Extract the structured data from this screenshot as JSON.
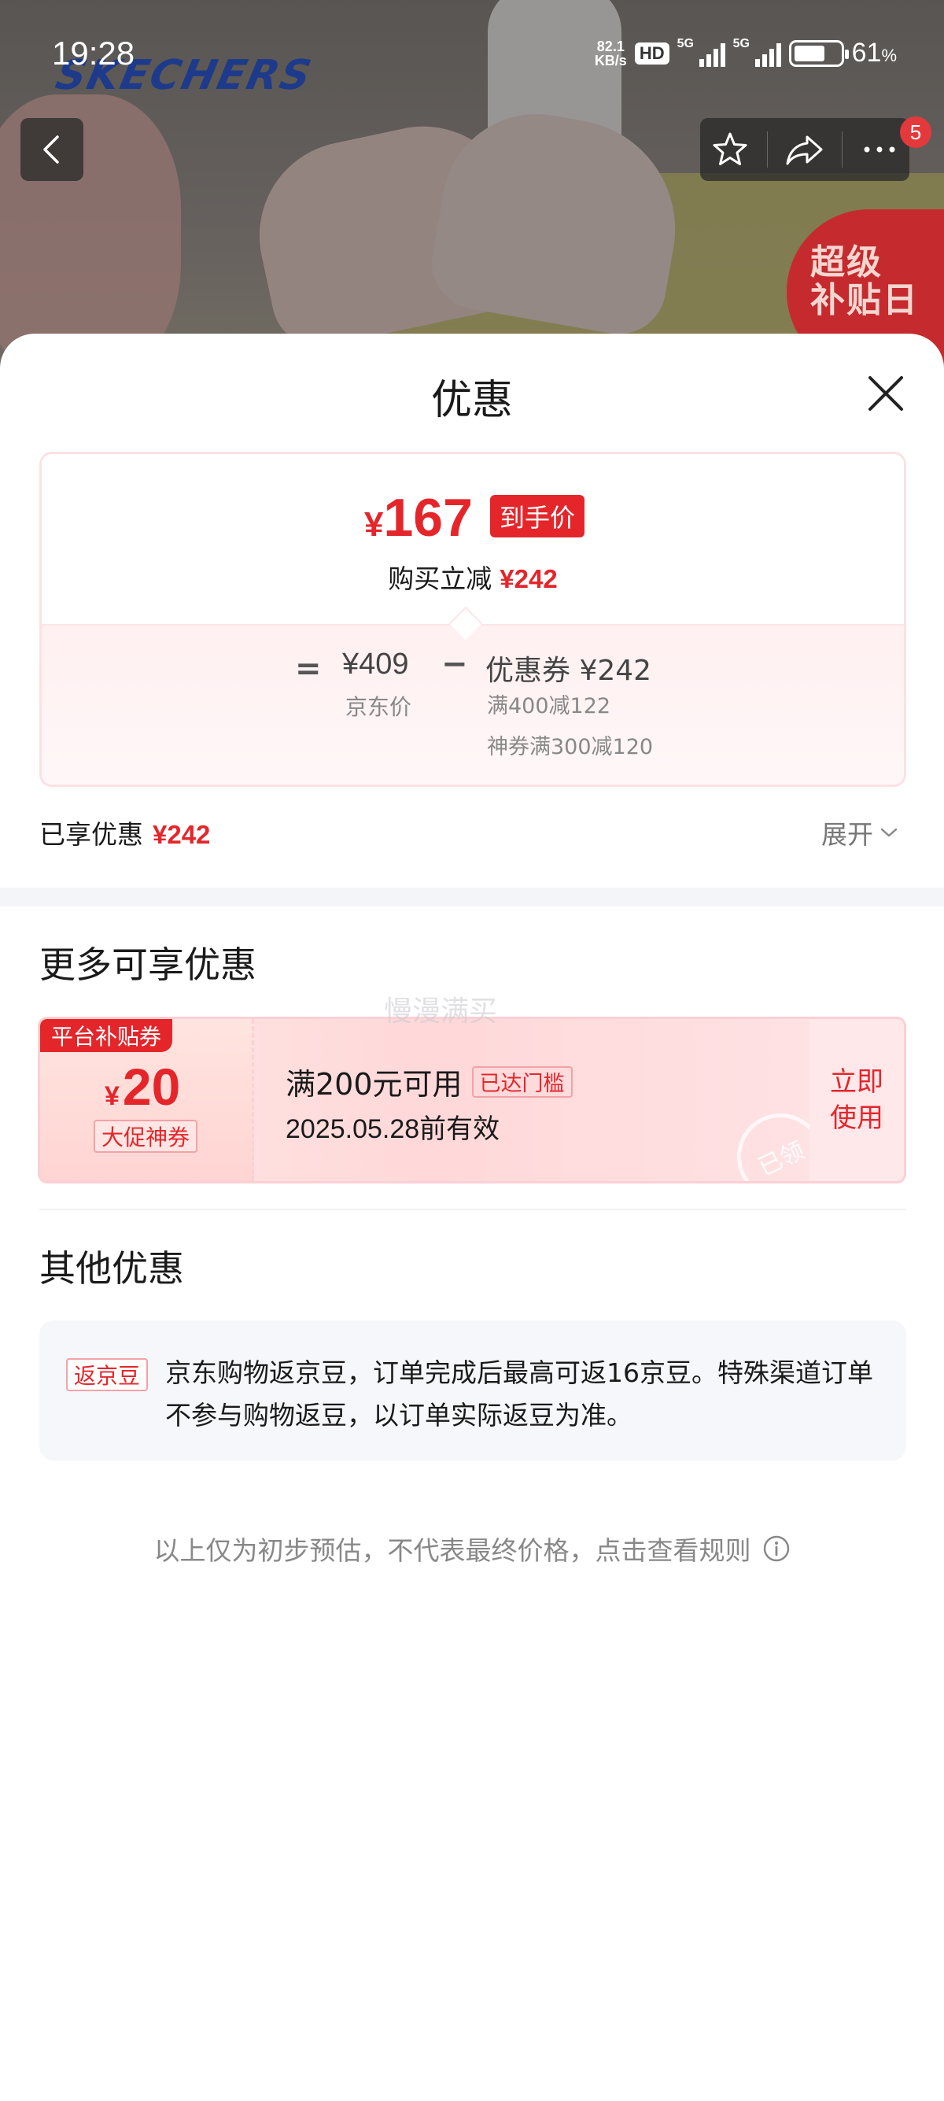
{
  "status_bar": {
    "time": "19:28",
    "net_speed_value": "82.1",
    "net_speed_unit": "KB/s",
    "hd_badge": "HD",
    "signal1_label": "5G",
    "signal2_label": "5G",
    "battery_percent": "61",
    "battery_percent_sign": "%"
  },
  "header": {
    "brand_logo": "SKECHERS",
    "back_icon": "chevron-left-icon",
    "favorite_icon": "star-icon",
    "share_icon": "share-icon",
    "more_icon": "more-dots-icon",
    "notification_count": "5",
    "promo_seal_line1": "超级",
    "promo_seal_line2": "补贴日"
  },
  "sheet": {
    "title": "优惠",
    "close_icon": "close-icon"
  },
  "price_card": {
    "final_price_symbol": "¥",
    "final_price": "167",
    "final_price_tag": "到手价",
    "instant_discount_label": "购买立减",
    "instant_discount_value": "¥242",
    "equals_sign": "=",
    "jd_price": "¥409",
    "jd_price_label": "京东价",
    "minus_sign": "−",
    "coupon_title": "优惠券 ¥242",
    "coupon_lines": [
      "满400减122",
      "神券满300减120"
    ]
  },
  "enjoyed": {
    "label": "已享优惠",
    "value": "¥242",
    "expand_label": "展开"
  },
  "more_offers": {
    "title": "更多可享优惠",
    "watermark": "慢漫满买",
    "coupon": {
      "tag": "平台补贴券",
      "currency": "¥",
      "amount": "20",
      "subtitle": "大促神券",
      "condition": "满200元可用",
      "reached_badge": "已达门槛",
      "valid_until": "2025.05.28前有效",
      "use_button_line1": "立即",
      "use_button_line2": "使用",
      "claimed_stamp": "已领"
    }
  },
  "other_offers": {
    "title": "其他优惠",
    "tag": "返京豆",
    "text": "京东购物返京豆，订单完成后最高可返16京豆。特殊渠道订单不参与购物返豆，以订单实际返豆为准。"
  },
  "disclaimer": {
    "text": "以上仅为初步预估，不代表最终价格，点击查看规则",
    "icon": "info-icon"
  },
  "colors": {
    "accent_red": "#e4262b",
    "badge_border": "#f3a2a6",
    "page_bg": "#ffffff",
    "band_gray": "#f4f5f9"
  }
}
